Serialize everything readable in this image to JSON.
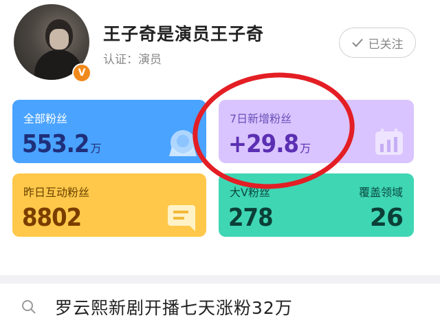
{
  "profile": {
    "name": "王子奇是演员王子奇",
    "certification": "认证：演员",
    "badge_icon": "verified-v-icon",
    "follow_label": "已关注"
  },
  "stats": {
    "total_fans": {
      "label": "全部粉丝",
      "value": "553.2",
      "unit": "万",
      "icon": "chat-bubble-face-icon"
    },
    "weekly_new_fans": {
      "label": "7日新增粉丝",
      "value": "+29.8",
      "unit": "万",
      "icon": "bar-chart-calendar-icon"
    },
    "yesterday_interactive_fans": {
      "label": "昨日互动粉丝",
      "value": "8802",
      "icon": "message-lines-icon"
    },
    "bottom_right": {
      "label_left": "大V粉丝",
      "value_left": "278",
      "label_right": "覆盖领域",
      "value_right": "26"
    }
  },
  "search": {
    "query": "罗云熙新剧开播七天涨粉32万",
    "icon": "search-icon"
  },
  "colors": {
    "blue_card": "#4aa3ff",
    "purple_card": "#d9c4ff",
    "yellow_card": "#ffc84a",
    "teal_card": "#3fd6b4",
    "highlight_circle": "#e31e24",
    "verified_badge": "#f08a1c"
  }
}
